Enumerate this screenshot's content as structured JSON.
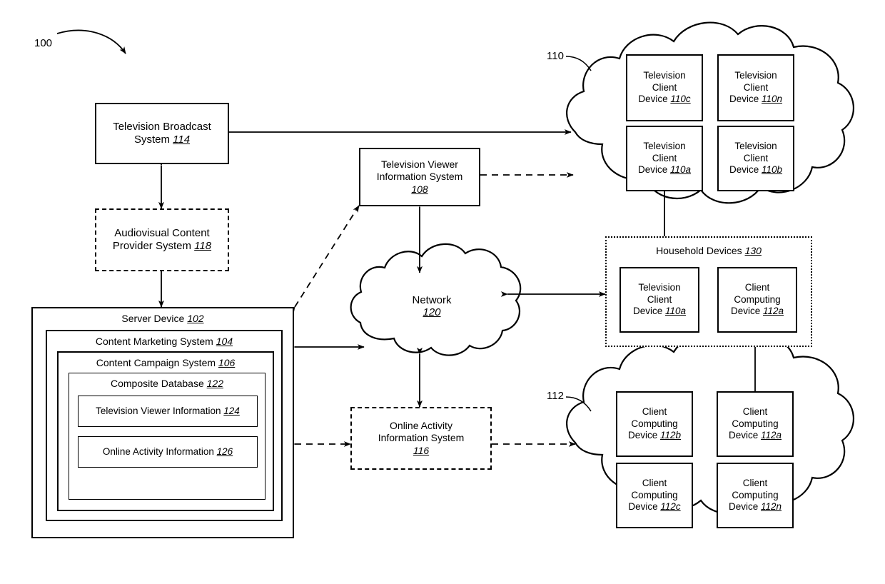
{
  "figure": {
    "figure_number": "100",
    "reference_110": "110",
    "reference_112": "112"
  },
  "nodes": {
    "tv_broadcast": {
      "line1": "Television Broadcast",
      "line2": "System",
      "ref": "114"
    },
    "av_provider": {
      "line1": "Audiovisual Content",
      "line2": "Provider System",
      "ref": "118"
    },
    "tv_viewer_info_system": {
      "line1": "Television Viewer",
      "line2": "Information System",
      "ref": "108"
    },
    "online_activity_info_system": {
      "line1": "Online Activity",
      "line2": "Information System",
      "ref": "116"
    },
    "network": {
      "line1": "Network",
      "ref": "120"
    },
    "server_device": {
      "label": "Server Device",
      "ref": "102"
    },
    "content_marketing_system": {
      "label": "Content Marketing System",
      "ref": "104"
    },
    "content_campaign_system": {
      "label": "Content Campaign System",
      "ref": "106"
    },
    "composite_database": {
      "label": "Composite Database",
      "ref": "122"
    },
    "television_viewer_information": {
      "label": "Television Viewer Information",
      "ref": "124"
    },
    "online_activity_information": {
      "label": "Online Activity Information",
      "ref": "126"
    },
    "household_devices": {
      "label": "Household Devices",
      "ref": "130"
    }
  },
  "clouds": {
    "television_clients": {
      "ref": "110",
      "devices": [
        {
          "line1": "Television",
          "line2": "Client",
          "line3": "Device",
          "ref": "110c"
        },
        {
          "line1": "Television",
          "line2": "Client",
          "line3": "Device",
          "ref": "110n"
        },
        {
          "line1": "Television",
          "line2": "Client",
          "line3": "Device",
          "ref": "110a"
        },
        {
          "line1": "Television",
          "line2": "Client",
          "line3": "Device",
          "ref": "110b"
        }
      ]
    },
    "client_computing": {
      "ref": "112",
      "devices": [
        {
          "line1": "Client",
          "line2": "Computing",
          "line3": "Device",
          "ref": "112b"
        },
        {
          "line1": "Client",
          "line2": "Computing",
          "line3": "Device",
          "ref": "112a"
        },
        {
          "line1": "Client",
          "line2": "Computing",
          "line3": "Device",
          "ref": "112c"
        },
        {
          "line1": "Client",
          "line2": "Computing",
          "line3": "Device",
          "ref": "112n"
        }
      ]
    }
  },
  "household": {
    "devices": [
      {
        "line1": "Television",
        "line2": "Client",
        "line3": "Device",
        "ref": "110a"
      },
      {
        "line1": "Client",
        "line2": "Computing",
        "line3": "Device",
        "ref": "112a"
      }
    ]
  },
  "colors": {
    "stroke": "#000000",
    "background": "#ffffff"
  }
}
